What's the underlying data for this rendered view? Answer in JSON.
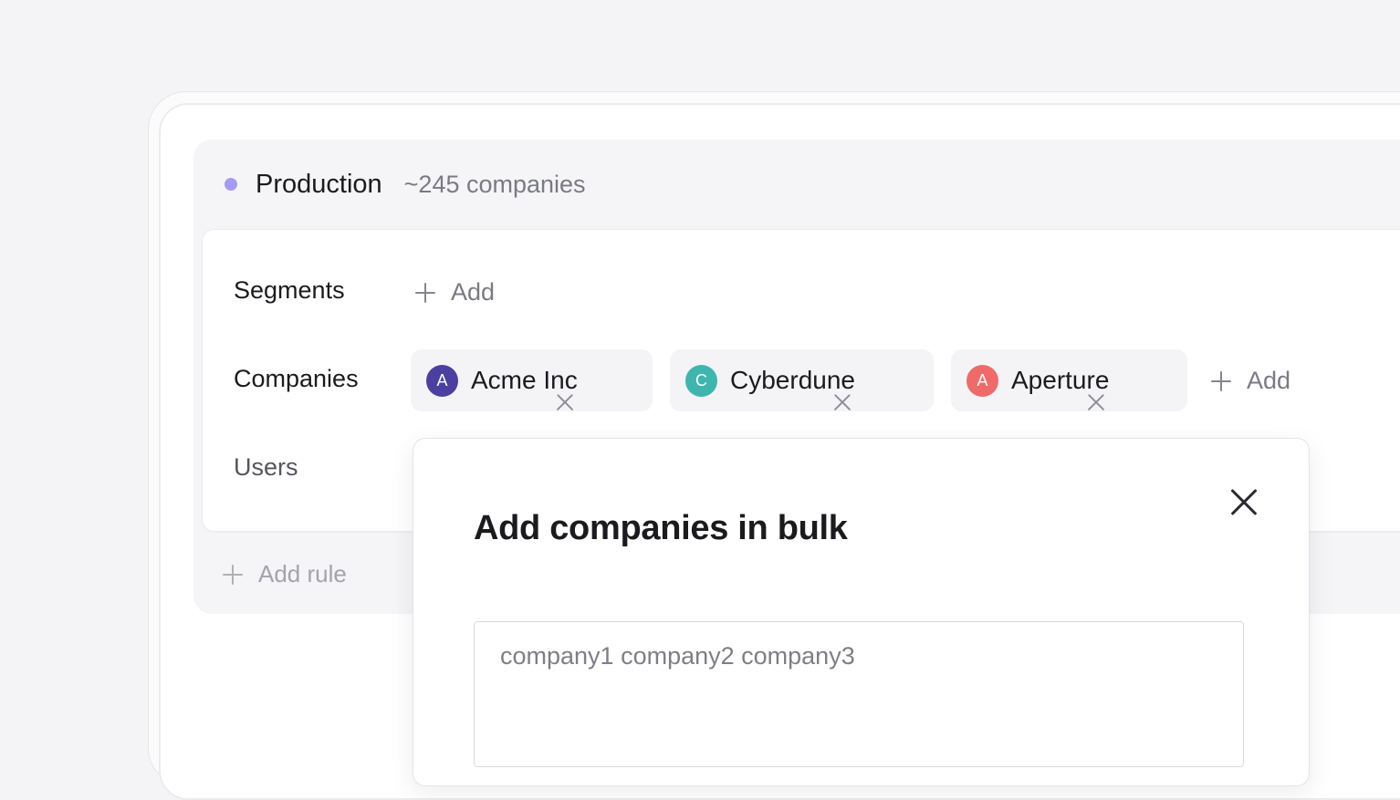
{
  "environment": {
    "name": "Production",
    "count": "~245 companies",
    "dot_color": "#a59bf4"
  },
  "rules": {
    "segments": {
      "label": "Segments",
      "add_label": "Add"
    },
    "companies": {
      "label": "Companies",
      "add_label": "Add",
      "items": [
        {
          "initial": "A",
          "name": "Acme Inc",
          "color": "#4b3fa1"
        },
        {
          "initial": "C",
          "name": "Cyberdune",
          "color": "#3fb6ad"
        },
        {
          "initial": "A",
          "name": "Aperture",
          "color": "#f06a6a"
        }
      ]
    },
    "users": {
      "label": "Users"
    },
    "add_rule_label": "Add rule"
  },
  "modal": {
    "title": "Add companies in bulk",
    "textarea_placeholder": "company1 company2 company3"
  },
  "icons": {
    "plus": "plus-icon",
    "close": "close-icon",
    "remove": "x-icon",
    "status_dot": "status-dot-icon"
  }
}
